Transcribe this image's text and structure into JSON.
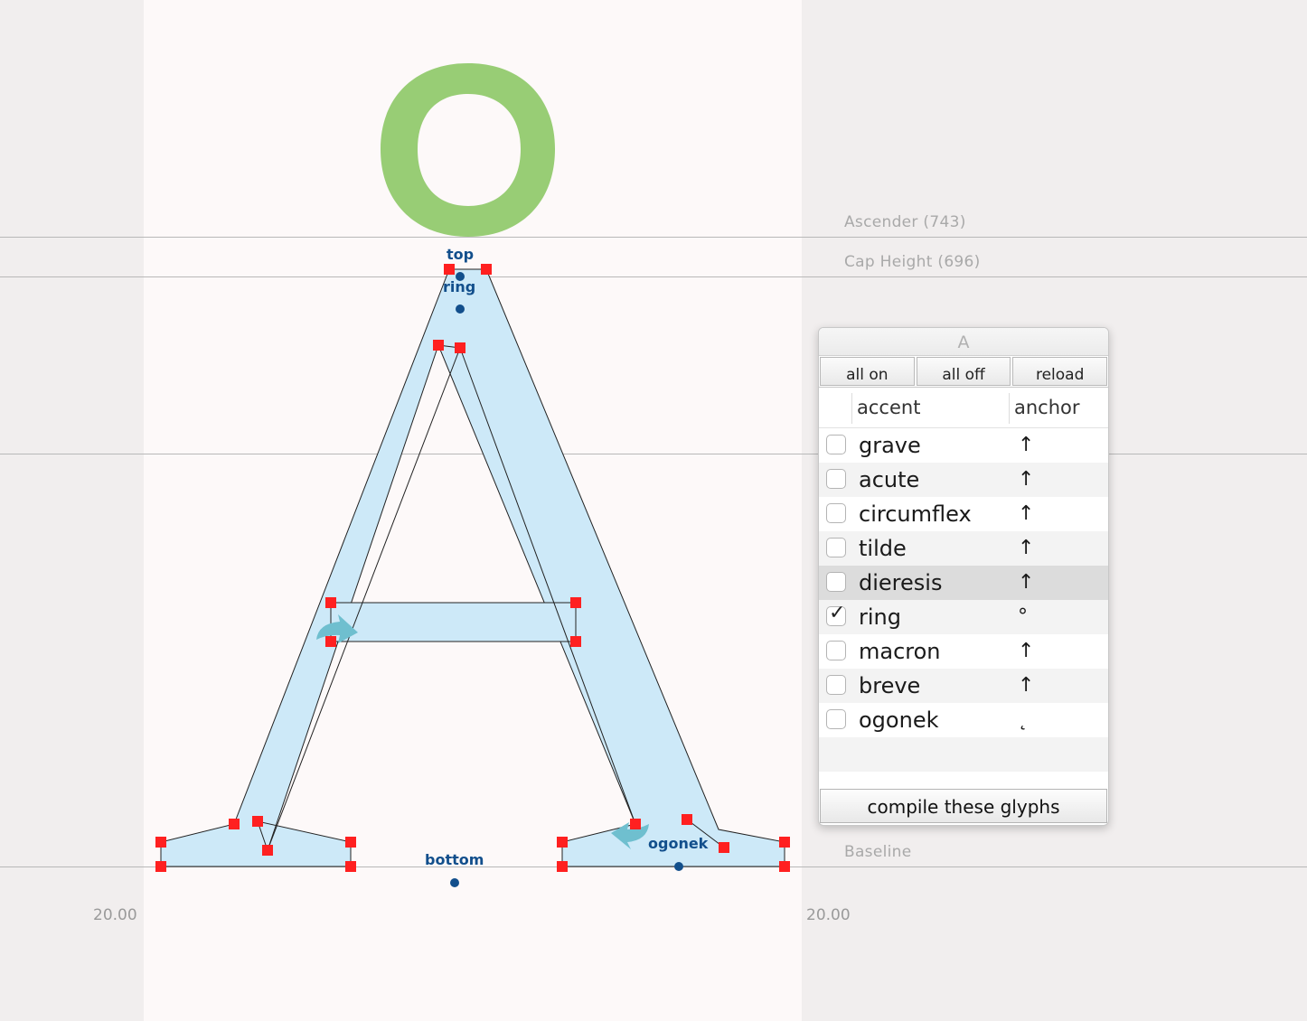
{
  "editor": {
    "metrics": {
      "ascender": "Ascender (743)",
      "cap_height": "Cap Height (696)",
      "baseline": "Baseline"
    },
    "anchors": {
      "top": "top",
      "ring": "ring",
      "bottom": "bottom",
      "ogonek": "ogonek"
    },
    "sidebearing_left": "20.00",
    "sidebearing_right": "20.00",
    "colors": {
      "glyph_fill": "#cde9f8",
      "glyph_stroke": "#222222",
      "point": "#ff2020",
      "accent_preview": "#98cd75",
      "anchor": "#124f8c",
      "start_arrow": "#6fbfcf",
      "glyph_area": "#fdf9f9",
      "background": "#f1eeee"
    }
  },
  "panel": {
    "title": "A",
    "buttons": {
      "all_on": "all on",
      "all_off": "all off",
      "reload": "reload"
    },
    "columns": {
      "accent": "accent",
      "anchor": "anchor"
    },
    "rows": [
      {
        "accent": "grave",
        "glyph": "↑",
        "checked": false
      },
      {
        "accent": "acute",
        "glyph": "↑",
        "checked": false
      },
      {
        "accent": "circumflex",
        "glyph": "↑",
        "checked": false
      },
      {
        "accent": "tilde",
        "glyph": "↑",
        "checked": false
      },
      {
        "accent": "dieresis",
        "glyph": "↑",
        "checked": false
      },
      {
        "accent": "ring",
        "glyph": "°",
        "checked": true
      },
      {
        "accent": "macron",
        "glyph": "↑",
        "checked": false
      },
      {
        "accent": "breve",
        "glyph": "↑",
        "checked": false
      },
      {
        "accent": "ogonek",
        "glyph": "˛",
        "checked": false
      }
    ],
    "compile_button": "compile these glyphs"
  }
}
